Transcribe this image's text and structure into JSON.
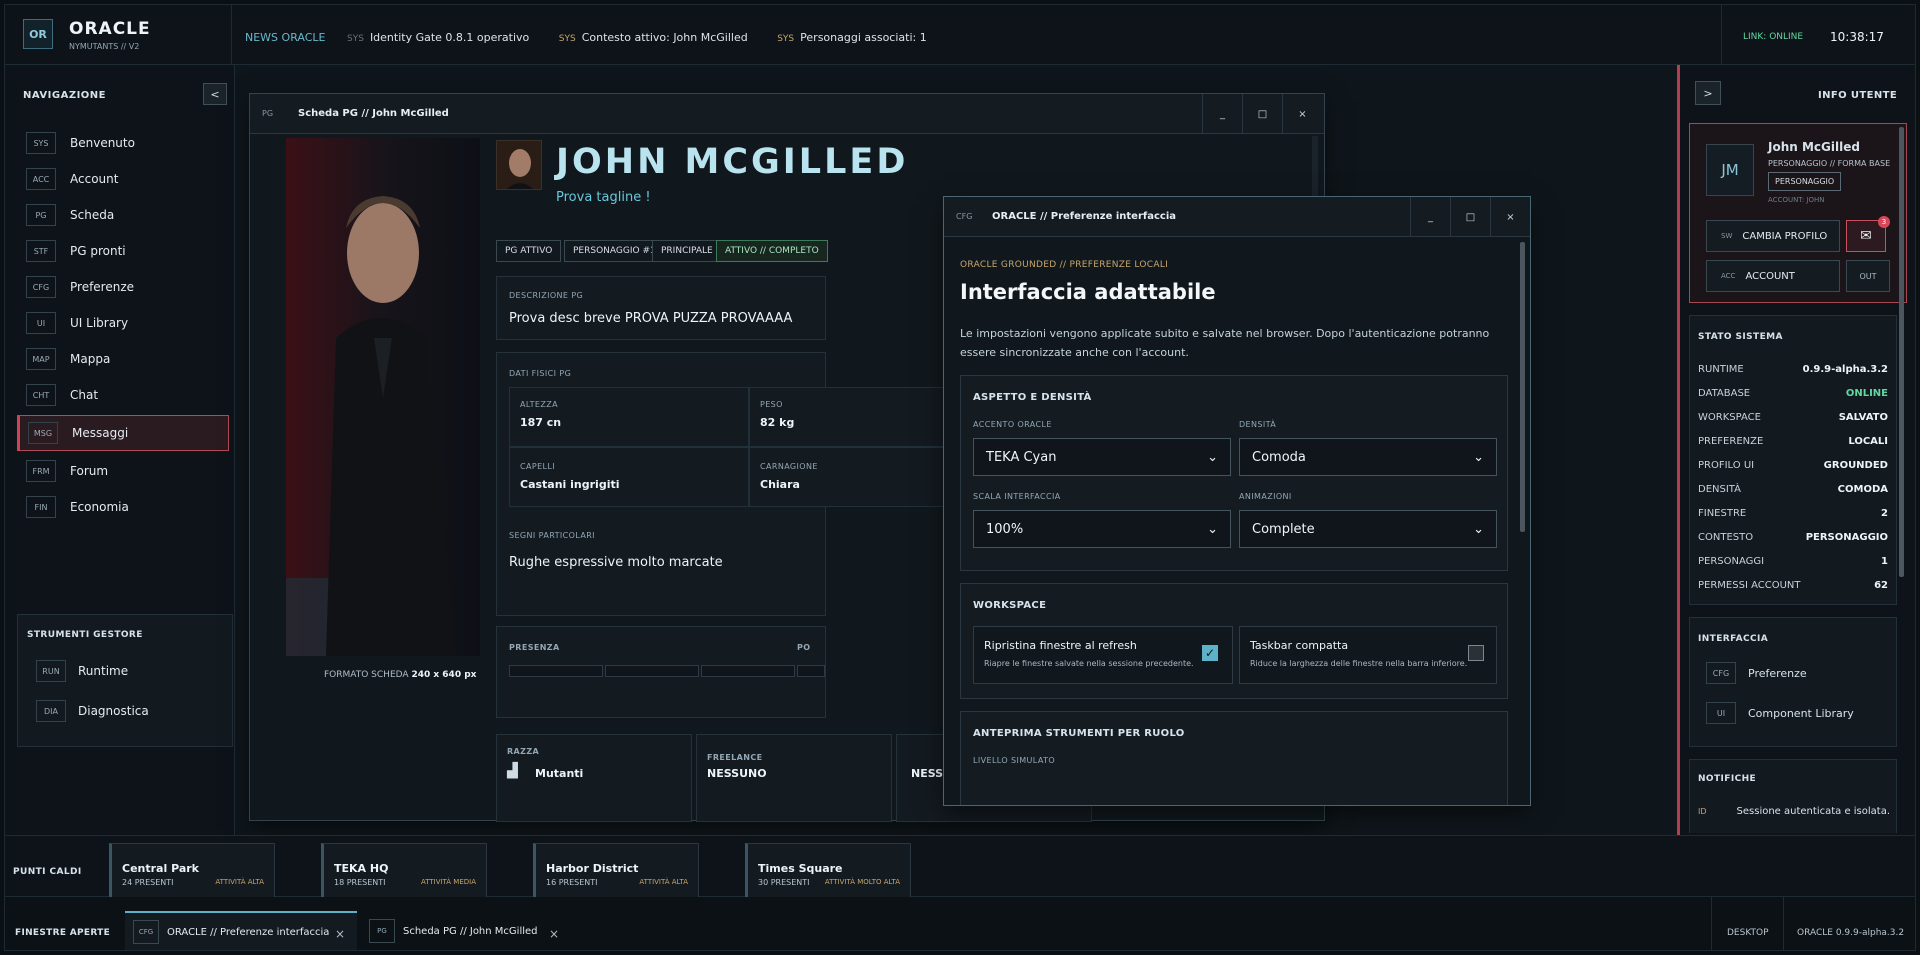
{
  "app": {
    "logo": "OR",
    "title": "ORACLE",
    "subtitle": "NYMUTANTS // V2"
  },
  "topbar": {
    "news_label": "NEWS ORACLE",
    "ticker": [
      {
        "tag": "SYS",
        "text": "Identity Gate 0.8.1 operativo"
      },
      {
        "tag": "SYS",
        "text": "Contesto attivo: John McGilled"
      },
      {
        "tag": "SYS",
        "text": "Personaggi associati: 1"
      }
    ],
    "link_status": "LINK: ONLINE",
    "clock": "10:38:17"
  },
  "nav": {
    "header": "NAVIGAZIONE",
    "collapse": "<",
    "items": [
      {
        "icon": "SYS",
        "label": "Benvenuto"
      },
      {
        "icon": "ACC",
        "label": "Account"
      },
      {
        "icon": "PG",
        "label": "Scheda"
      },
      {
        "icon": "STF",
        "label": "PG pronti"
      },
      {
        "icon": "CFG",
        "label": "Preferenze"
      },
      {
        "icon": "UI",
        "label": "UI Library"
      },
      {
        "icon": "MAP",
        "label": "Mappa"
      },
      {
        "icon": "CHT",
        "label": "Chat"
      },
      {
        "icon": "MSG",
        "label": "Messaggi"
      },
      {
        "icon": "FRM",
        "label": "Forum"
      },
      {
        "icon": "FIN",
        "label": "Economia"
      }
    ],
    "tools_title": "STRUMENTI GESTORE",
    "tools": [
      {
        "icon": "RUN",
        "label": "Runtime"
      },
      {
        "icon": "DIA",
        "label": "Diagnostica"
      }
    ]
  },
  "sheet": {
    "tag": "PG",
    "title": "Scheda PG // John McGilled",
    "name": "JOHN MCGILLED",
    "tagline": "Prova tagline !",
    "chips": [
      "PG ATTIVO",
      "PERSONAGGIO #1",
      "PRINCIPALE",
      "ATTIVO // COMPLETO"
    ],
    "desc_label": "DESCRIZIONE PG",
    "desc": "Prova desc breve PROVA PUZZA PROVAAAA",
    "phys_label": "DATI FISICI PG",
    "height_label": "ALTEZZA",
    "height": "187 cn",
    "weight_label": "PESO",
    "weight": "82 kg",
    "hair_label": "CAPELLI",
    "hair": "Castani ingrigiti",
    "skin_label": "CARNAGIONE",
    "skin": "Chiara",
    "marks_label": "SEGNI PARTICOLARI",
    "marks": "Rughe espressive molto marcate",
    "presence_label": "PRESENZA",
    "presence_right": "PO",
    "format_prefix": "FORMATO SCHEDA",
    "format_value": "240 x 640 px",
    "race_label": "RAZZA",
    "race": "Mutanti",
    "freelance_label": "FREELANCE",
    "freelance": "NESSUNO",
    "extra_value": "NESSUNO",
    "controls": {
      "min": "_",
      "max": "□",
      "close": "×"
    }
  },
  "prefs": {
    "tag": "CFG",
    "title": "ORACLE // Preferenze interfaccia",
    "eyebrow": "ORACLE GROUNDED // PREFERENZE LOCALI",
    "heading": "Interfaccia adattabile",
    "intro": "Le impostazioni vengono applicate subito e salvate nel browser. Dopo l'autenticazione potranno essere sincronizzate anche con l'account.",
    "appearance_title": "ASPETTO E DENSITÀ",
    "accent_label": "ACCENTO ORACLE",
    "accent": "TEKA Cyan",
    "density_label": "DENSITÀ",
    "density": "Comoda",
    "scale_label": "SCALA INTERFACCIA",
    "scale": "100%",
    "anim_label": "ANIMAZIONI",
    "anim": "Complete",
    "workspace_title": "WORKSPACE",
    "restore_title": "Ripristina finestre al refresh",
    "restore_sub": "Riapre le finestre salvate nella sessione precedente.",
    "restore_checked": true,
    "compact_title": "Taskbar compatta",
    "compact_sub": "Riduce la larghezza delle finestre nella barra inferiore.",
    "compact_checked": false,
    "preview_title": "ANTEPRIMA STRUMENTI PER RUOLO",
    "level_label": "LIVELLO SIMULATO"
  },
  "user": {
    "header": "INFO UTENTE",
    "collapse": ">",
    "initials": "JM",
    "name": "John McGilled",
    "role": "PERSONAGGIO // FORMA BASE",
    "badge": "PERSONAGGIO",
    "account": "ACCOUNT: JOHN",
    "switch_icon": "SW",
    "switch_label": "CAMBIA PROFILO",
    "mail_count": "3",
    "acc_icon": "ACC",
    "acc_label": "ACCOUNT",
    "out_label": "OUT"
  },
  "system": {
    "title": "STATO SISTEMA",
    "rows": [
      {
        "k": "RUNTIME",
        "v": "0.9.9-alpha.3.2"
      },
      {
        "k": "DATABASE",
        "v": "ONLINE"
      },
      {
        "k": "WORKSPACE",
        "v": "SALVATO"
      },
      {
        "k": "PREFERENZE",
        "v": "LOCALI"
      },
      {
        "k": "PROFILO UI",
        "v": "GROUNDED"
      },
      {
        "k": "DENSITÀ",
        "v": "COMODA"
      },
      {
        "k": "FINESTRE",
        "v": "2"
      },
      {
        "k": "CONTESTO",
        "v": "PERSONAGGIO"
      },
      {
        "k": "PERSONAGGI",
        "v": "1"
      },
      {
        "k": "PERMESSI ACCOUNT",
        "v": "62"
      }
    ]
  },
  "interface": {
    "title": "INTERFACCIA",
    "items": [
      {
        "icon": "CFG",
        "label": "Preferenze"
      },
      {
        "icon": "UI",
        "label": "Component Library"
      }
    ]
  },
  "notifications": {
    "title": "NOTIFICHE",
    "id": "ID",
    "text": "Sessione autenticata e isolata."
  },
  "hotspots": {
    "label": "PUNTI CALDI",
    "items": [
      {
        "name": "Central Park",
        "count": "24 PRESENTI",
        "activity": "ATTIVITÀ ALTA"
      },
      {
        "name": "TEKA HQ",
        "count": "18 PRESENTI",
        "activity": "ATTIVITÀ MEDIA"
      },
      {
        "name": "Harbor District",
        "count": "16 PRESENTI",
        "activity": "ATTIVITÀ ALTA"
      },
      {
        "name": "Times Square",
        "count": "30 PRESENTI",
        "activity": "ATTIVITÀ MOLTO ALTA"
      }
    ]
  },
  "taskbar": {
    "label": "FINESTRE APERTE",
    "items": [
      {
        "icon": "CFG",
        "label": "ORACLE // Preferenze interfaccia"
      },
      {
        "icon": "PG",
        "label": "Scheda PG // John McGilled"
      }
    ],
    "close": "×",
    "desktop": "DESKTOP",
    "version": "ORACLE 0.9.9-alpha.3.2"
  },
  "colors": {
    "accent": "#5eb2c8",
    "alert": "#d04354",
    "ok": "#62d6a0",
    "warn": "#c7a56d"
  }
}
